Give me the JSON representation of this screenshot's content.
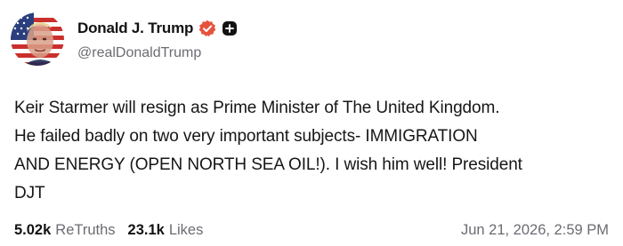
{
  "account": {
    "display_name": "Donald J. Trump",
    "handle": "@realDonaldTrump",
    "avatar_icon": "user-avatar-icon",
    "verified_icon": "verified-badge-icon",
    "plus_icon": "plus-badge-icon"
  },
  "post": {
    "text": "Keir Starmer will resign as Prime Minister of The United Kingdom.\nHe failed badly on two very important subjects- IMMIGRATION\nAND ENERGY (OPEN NORTH SEA OIL!). I wish him well! President\nDJT"
  },
  "stats": {
    "retruths_count": "5.02k",
    "retruths_label": "ReTruths",
    "likes_count": "23.1k",
    "likes_label": "Likes"
  },
  "timestamp": "Jun 21, 2026, 2:59 PM",
  "colors": {
    "verified_badge": "#e5533e",
    "text_primary": "#121212",
    "text_secondary": "#6b6b73"
  }
}
